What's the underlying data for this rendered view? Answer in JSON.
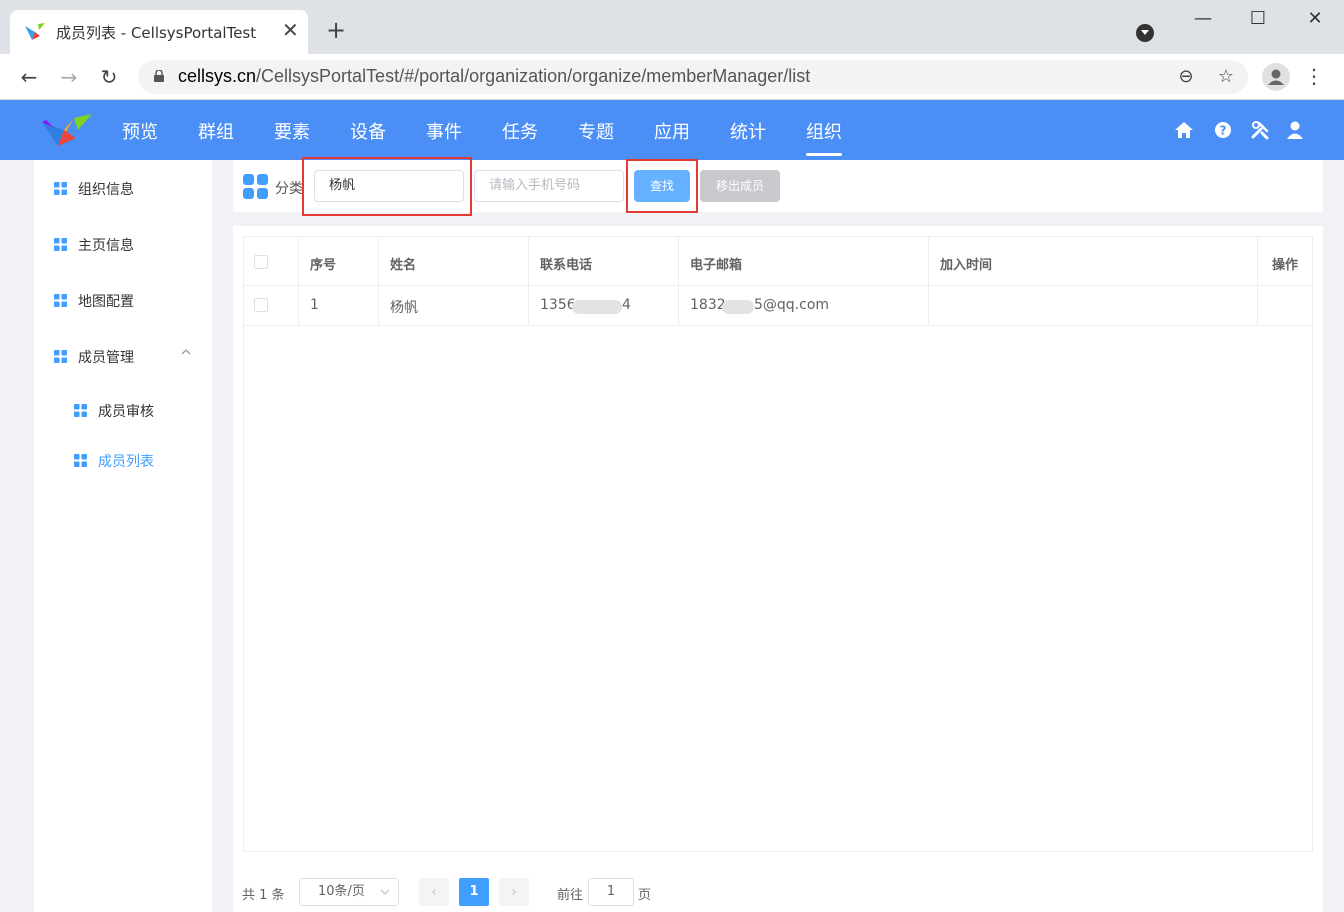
{
  "browser": {
    "tab_title": "成员列表 - CellsysPortalTest",
    "url_host": "cellsys.cn",
    "url_path": "/CellsysPortalTest/#/portal/organization/organize/memberManager/list"
  },
  "nav": {
    "items": [
      "预览",
      "群组",
      "要素",
      "设备",
      "事件",
      "任务",
      "专题",
      "应用",
      "统计",
      "组织"
    ],
    "active": "组织"
  },
  "sidebar": {
    "items": [
      {
        "label": "组织信息"
      },
      {
        "label": "主页信息"
      },
      {
        "label": "地图配置"
      },
      {
        "label": "成员管理"
      },
      {
        "label": "成员审核"
      },
      {
        "label": "成员列表"
      }
    ],
    "active": "成员列表"
  },
  "toolbar": {
    "category_label": "分类",
    "name_value": "杨帆",
    "phone_placeholder": "请输入手机号码",
    "search_label": "查找",
    "remove_label": "移出成员"
  },
  "table": {
    "headers": [
      "序号",
      "姓名",
      "联系电话",
      "电子邮箱",
      "加入时间",
      "操作"
    ],
    "rows": [
      {
        "index": "1",
        "name": "杨帆",
        "phone_prefix": "1356",
        "phone_suffix": "4",
        "email_prefix": "1832",
        "email_suffix": "5@qq.com",
        "join_time": "",
        "action": ""
      }
    ]
  },
  "pagination": {
    "total_text": "共 1 条",
    "page_size": "10条/页",
    "current_page": "1",
    "goto_label": "前往",
    "goto_value": "1",
    "page_unit": "页"
  },
  "colors": {
    "nav_bg": "#4a8ef6",
    "primary": "#409eff",
    "search_btn": "#66b1ff",
    "disabled_btn": "#c8c9cc",
    "highlight": "#e53935"
  }
}
